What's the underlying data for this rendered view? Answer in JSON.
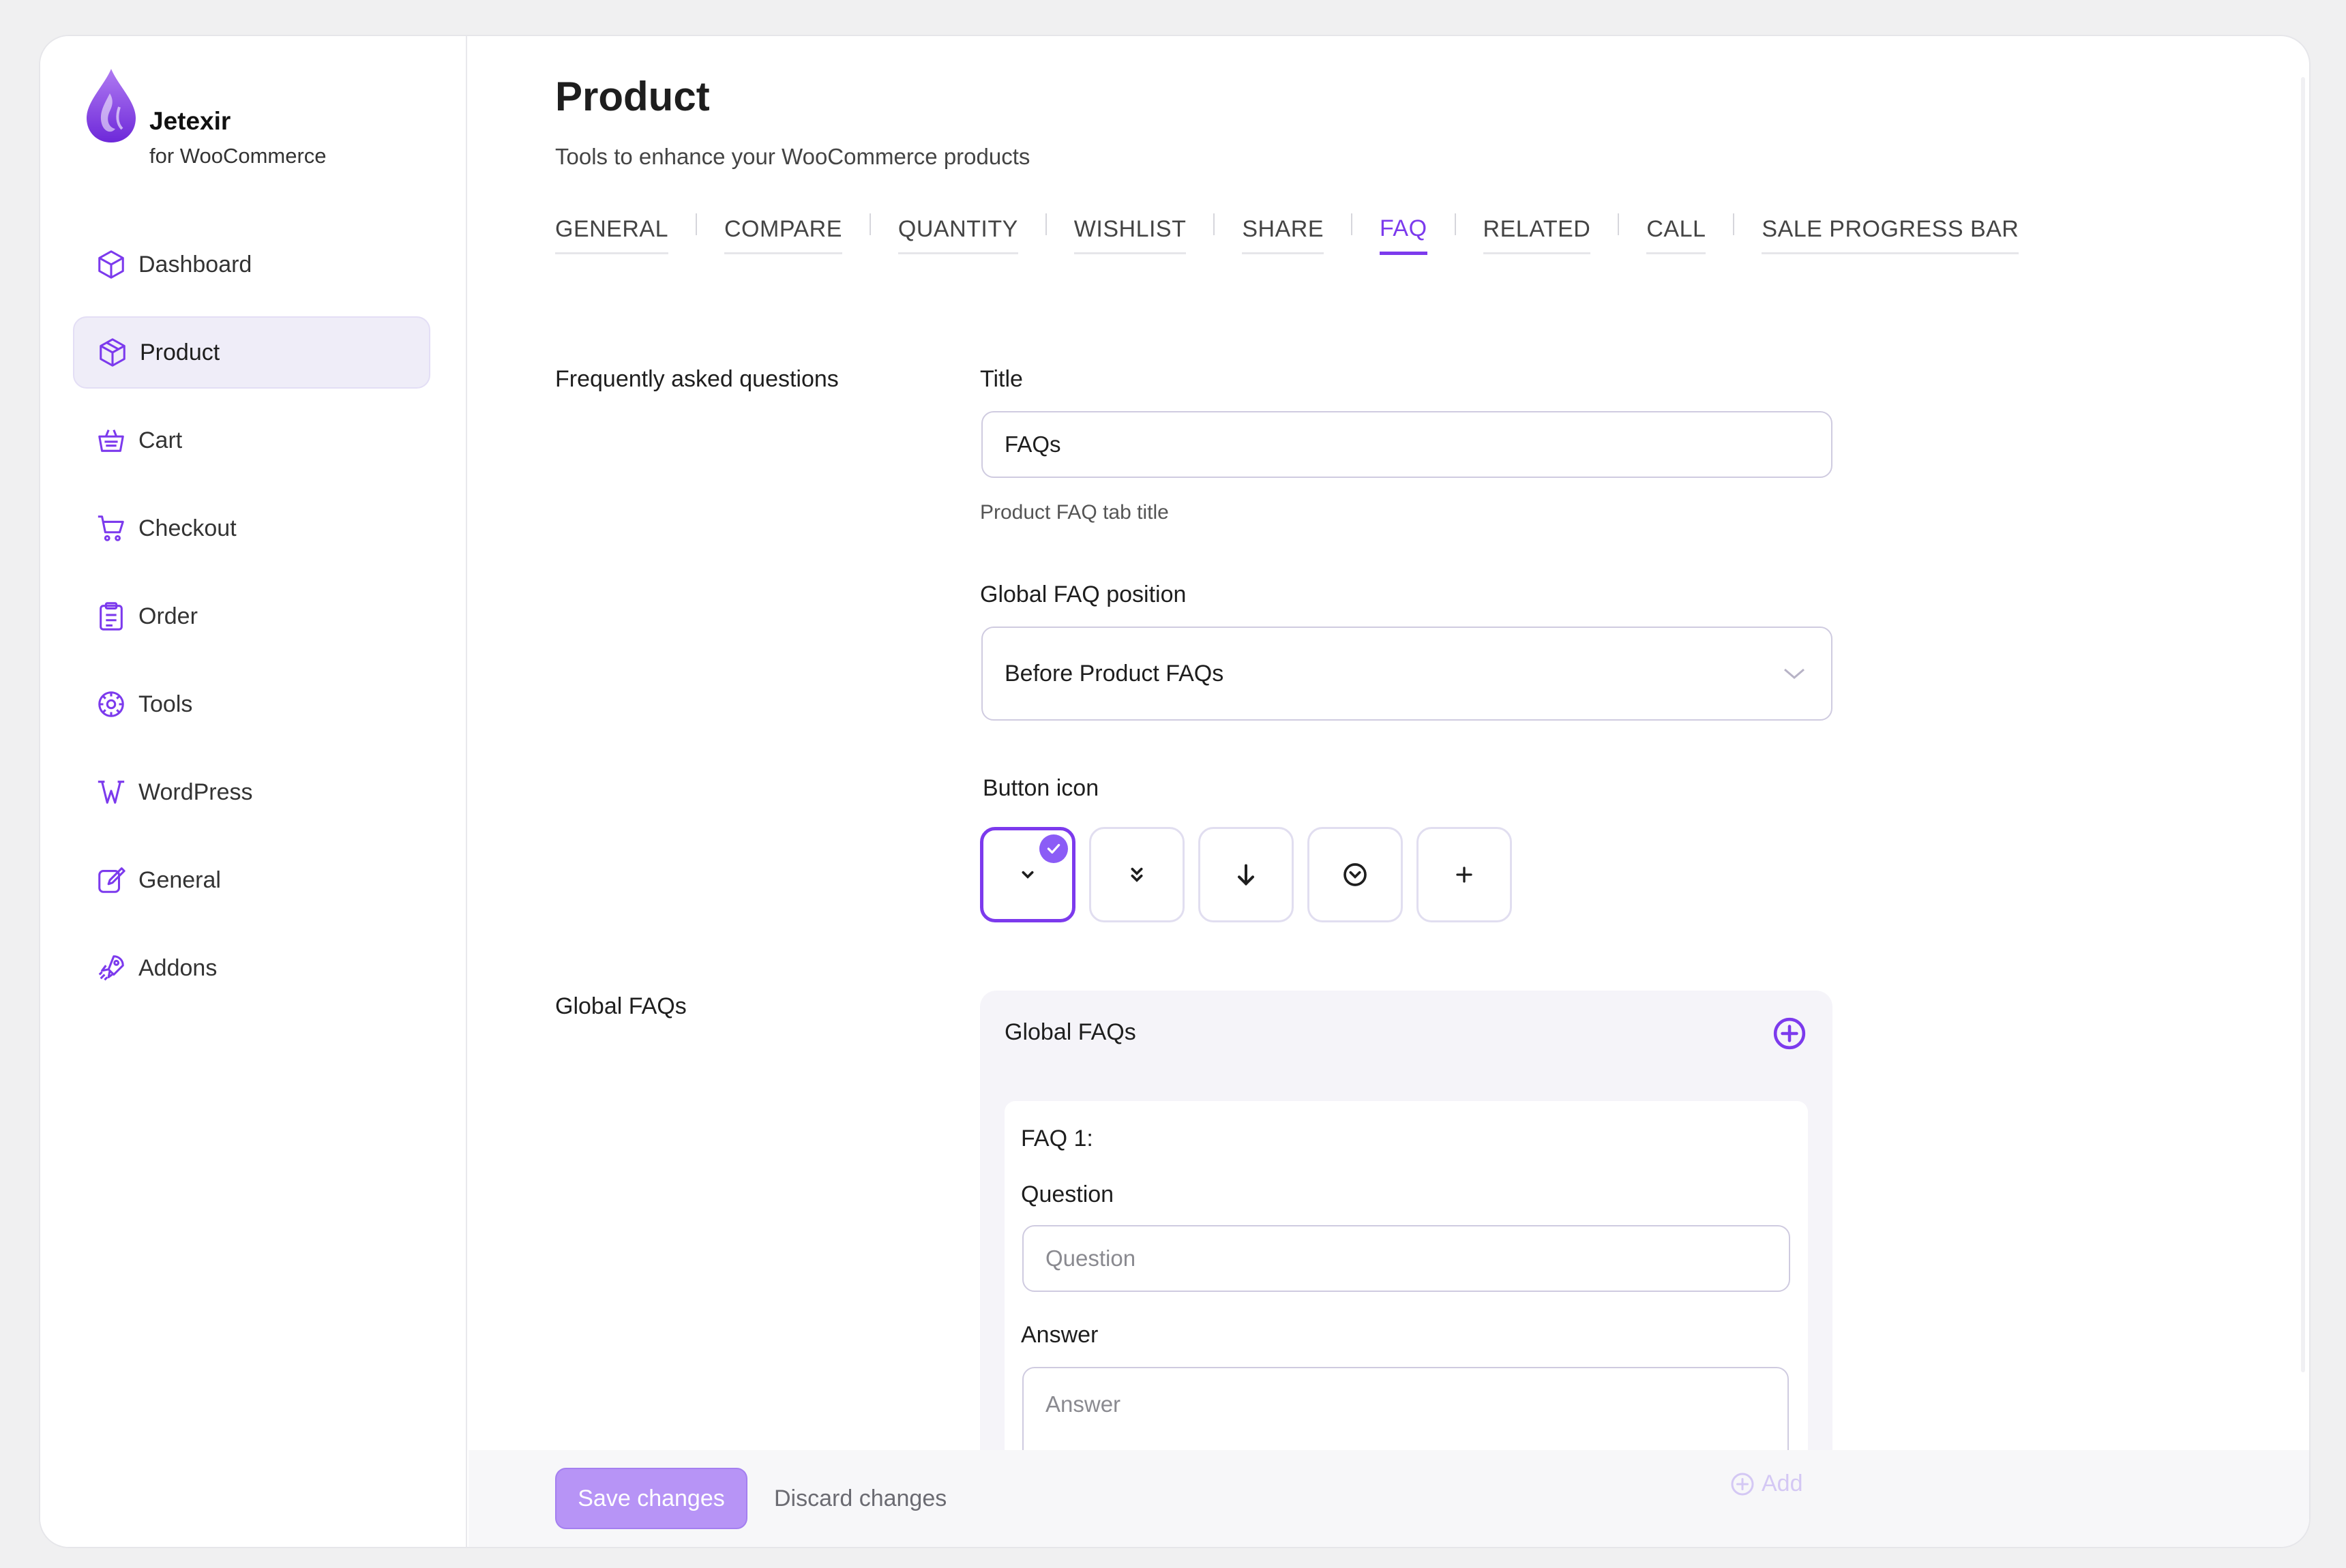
{
  "brand": {
    "name": "Jetexir",
    "subtitle": "for WooCommerce"
  },
  "sidebar": {
    "items": [
      {
        "label": "Dashboard",
        "icon": "cube-icon"
      },
      {
        "label": "Product",
        "icon": "box-icon",
        "active": true
      },
      {
        "label": "Cart",
        "icon": "basket-icon"
      },
      {
        "label": "Checkout",
        "icon": "cart-icon"
      },
      {
        "label": "Order",
        "icon": "clipboard-icon"
      },
      {
        "label": "Tools",
        "icon": "tools-icon"
      },
      {
        "label": "WordPress",
        "icon": "wordpress-icon"
      },
      {
        "label": "General",
        "icon": "edit-icon"
      },
      {
        "label": "Addons",
        "icon": "rocket-icon"
      }
    ]
  },
  "header": {
    "title": "Product",
    "subtitle": "Tools to enhance your WooCommerce products"
  },
  "tabs": [
    {
      "label": "GENERAL"
    },
    {
      "label": "COMPARE"
    },
    {
      "label": "QUANTITY"
    },
    {
      "label": "WISHLIST"
    },
    {
      "label": "SHARE"
    },
    {
      "label": "FAQ",
      "active": true
    },
    {
      "label": "RELATED"
    },
    {
      "label": "CALL"
    },
    {
      "label": "SALE PROGRESS BAR"
    }
  ],
  "faq_section": {
    "label": "Frequently asked questions",
    "title_label": "Title",
    "title_value": "FAQs",
    "title_help": "Product FAQ tab title",
    "position_label": "Global FAQ position",
    "position_value": "Before Product FAQs",
    "button_icon_label": "Button icon",
    "button_icons": [
      "chevron-down-icon",
      "double-chevron-down-icon",
      "arrow-down-icon",
      "circle-chevron-down-icon",
      "plus-icon"
    ],
    "selected_icon_index": 0
  },
  "global_faqs": {
    "label": "Global FAQs",
    "panel_title": "Global FAQs",
    "items": [
      {
        "title": "FAQ 1:",
        "question_label": "Question",
        "question_placeholder": "Question",
        "answer_label": "Answer",
        "answer_placeholder": "Answer"
      }
    ],
    "add_label": "Add"
  },
  "footer": {
    "save_label": "Save changes",
    "discard_label": "Discard changes"
  },
  "colors": {
    "accent": "#7c3aed",
    "accent_light": "#b794f6",
    "active_nav_bg": "#efedf8"
  }
}
